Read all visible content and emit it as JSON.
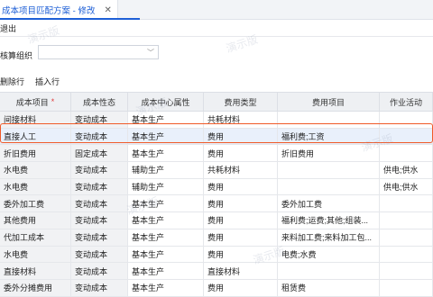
{
  "tab": {
    "title": "成本项目匹配方案 - 修改",
    "close": "✕"
  },
  "toolbar": {
    "exit_label": "退出"
  },
  "filter": {
    "org_label": "核算组织",
    "org_value": ""
  },
  "actions": {
    "delete_row": "删除行",
    "insert_row": "插入行"
  },
  "grid": {
    "columns": [
      "成本项目",
      "成本性态",
      "成本中心属性",
      "费用类型",
      "费用项目",
      "作业活动"
    ],
    "required_mark": "*",
    "rows": [
      [
        "间接材料",
        "变动成本",
        "基本生产",
        "共耗材料",
        "",
        ""
      ],
      [
        "直接人工",
        "变动成本",
        "基本生产",
        "费用",
        "福利费;工资",
        ""
      ],
      [
        "折旧费用",
        "固定成本",
        "基本生产",
        "费用",
        "折旧费用",
        ""
      ],
      [
        "水电费",
        "变动成本",
        "辅助生产",
        "共耗材料",
        "",
        "供电;供水"
      ],
      [
        "水电费",
        "变动成本",
        "辅助生产",
        "费用",
        "",
        "供电;供水"
      ],
      [
        "委外加工费",
        "变动成本",
        "基本生产",
        "费用",
        "委外加工费",
        ""
      ],
      [
        "其他费用",
        "变动成本",
        "基本生产",
        "费用",
        "福利费;运费;其他;组装...",
        ""
      ],
      [
        "代加工成本",
        "变动成本",
        "基本生产",
        "费用",
        "来料加工费;来料加工包...",
        ""
      ],
      [
        "水电费",
        "变动成本",
        "基本生产",
        "费用",
        "电费;水费",
        ""
      ],
      [
        "直接材料",
        "变动成本",
        "基本生产",
        "直接材料",
        "",
        ""
      ],
      [
        "委外分摊费用",
        "变动成本",
        "基本生产",
        "费用",
        "租赁费",
        ""
      ]
    ]
  },
  "watermark": "演示版"
}
